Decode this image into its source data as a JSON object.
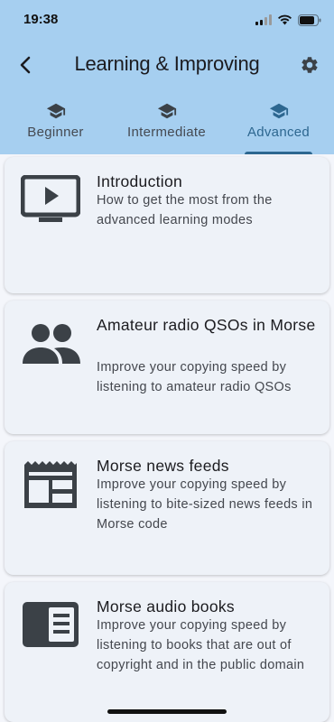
{
  "status_bar": {
    "time": "19:38"
  },
  "app_bar": {
    "title": "Learning & Improving",
    "back_icon": "chevron-left-icon",
    "settings_icon": "gear-icon"
  },
  "tabs": [
    {
      "label": "Beginner",
      "icon": "graduation-cap-icon",
      "active": false
    },
    {
      "label": "Intermediate",
      "icon": "graduation-cap-icon",
      "active": false
    },
    {
      "label": "Advanced",
      "icon": "graduation-cap-icon",
      "active": true
    }
  ],
  "cards": [
    {
      "title": "Introduction",
      "description": "How to get the most from the advanced learning modes",
      "icon": "monitor-play-icon"
    },
    {
      "title": "Amateur radio QSOs in Morse",
      "description": "Improve your copying speed by listening to amateur radio QSOs",
      "icon": "people-icon"
    },
    {
      "title": "Morse news feeds",
      "description": "Improve your copying speed by listening to bite-sized news feeds in Morse code",
      "icon": "newspaper-icon"
    },
    {
      "title": "Morse audio books",
      "description": "Improve your copying speed by listening to books that are out of copyright and in the public domain",
      "icon": "book-icon"
    }
  ],
  "colors": {
    "header_bg": "#a6cff0",
    "accent": "#2d6790",
    "card_bg": "#eef2f8",
    "icon": "#3b4147"
  }
}
